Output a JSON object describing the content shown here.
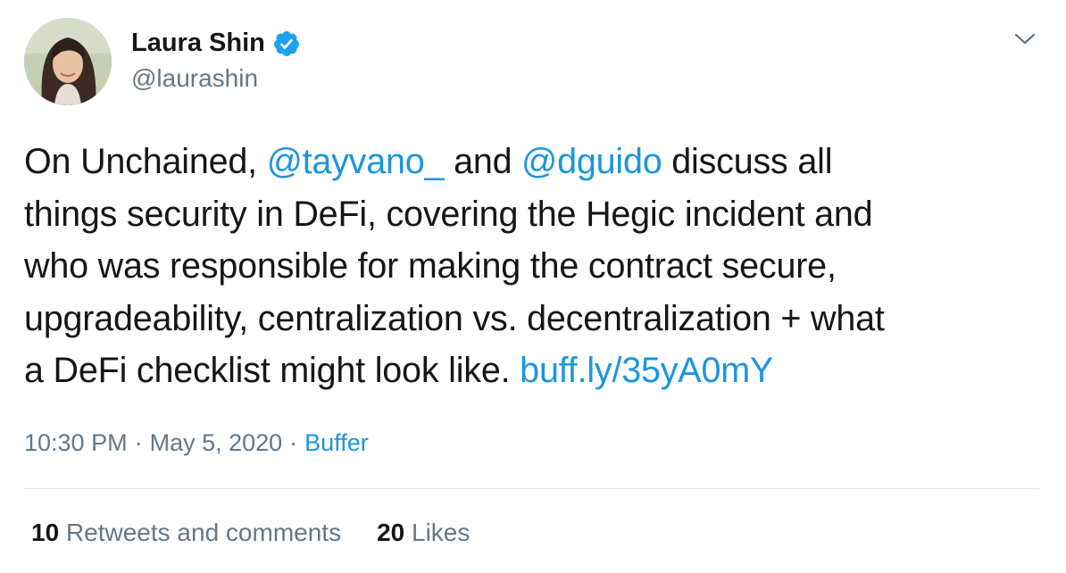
{
  "author": {
    "display_name": "Laura Shin",
    "handle": "@laurashin",
    "verified": true
  },
  "tweet": {
    "text_parts": [
      {
        "text": "On Unchained, "
      },
      {
        "text": "@tayvano_",
        "link": true
      },
      {
        "text": " and "
      },
      {
        "text": "@dguido",
        "link": true
      },
      {
        "text": " discuss all things security in DeFi, covering the Hegic incident and who was responsible for making the contract secure, upgradeability, centralization vs. decentralization + what a DeFi checklist might look like. "
      },
      {
        "text": "buff.ly/35yA0mY",
        "link": true
      }
    ]
  },
  "meta": {
    "time": "10:30 PM",
    "separator": "·",
    "date": "May 5, 2020",
    "source": "Buffer"
  },
  "stats": {
    "retweets_count": "10",
    "retweets_label": "Retweets and comments",
    "likes_count": "20",
    "likes_label": "Likes"
  },
  "colors": {
    "link": "#1b95e0",
    "text": "#14171a",
    "muted": "#657786",
    "divider": "#e1e8ed"
  },
  "icons": {
    "verified": "verified-badge-icon",
    "more": "chevron-down-icon"
  }
}
